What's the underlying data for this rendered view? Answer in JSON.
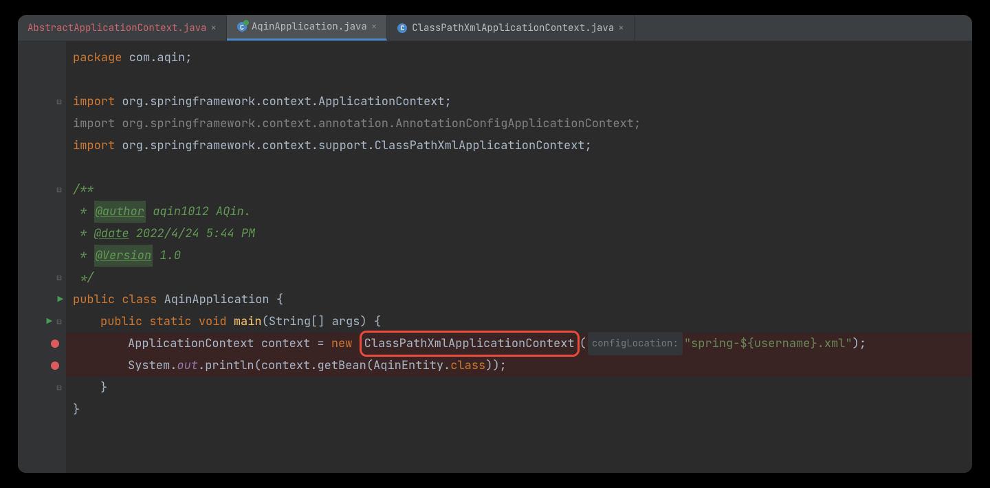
{
  "tabs": [
    {
      "label": "AbstractApplicationContext.java",
      "active": false,
      "error": true,
      "iconType": ""
    },
    {
      "label": "AqinApplication.java",
      "active": true,
      "error": false,
      "iconType": "c-active"
    },
    {
      "label": "ClassPathXmlApplicationContext.java",
      "active": false,
      "error": false,
      "iconType": "c"
    }
  ],
  "close_glyph": "×",
  "icon_c_letter": "C",
  "code": {
    "package_kw": "package ",
    "package_name": "com.aqin",
    "semicolon": ";",
    "import_kw": "import ",
    "import1": "org.springframework.context.ApplicationContext",
    "import2_full": "import org.springframework.context.annotation.AnnotationConfigApplicationContext;",
    "import3": "org.springframework.context.support.ClassPathXmlApplicationContext",
    "doc_open": "/**",
    "doc_star": " * ",
    "doc_author_tag": "@author",
    "doc_author_val": " aqin1012 AQin.",
    "doc_date_tag": "@date",
    "doc_date_val": " 2022/4/24 5:44 PM",
    "doc_version_tag": "@Version",
    "doc_version_val": " 1.0",
    "doc_close": " */",
    "public_kw": "public ",
    "class_kw": "class ",
    "class_name": "AqinApplication ",
    "brace_open": "{",
    "brace_close": "}",
    "static_kw": "static ",
    "void_kw": "void ",
    "main_name": "main",
    "main_args_open": "(",
    "string_type": "String",
    "brackets": "[] ",
    "args_name": "args",
    "main_args_close": ") ",
    "ctx_type": "ApplicationContext ",
    "ctx_var": "context ",
    "equals": "= ",
    "new_kw": "new ",
    "ctor_name": "ClassPathXmlApplicationContext",
    "paren_open": "(",
    "hint_config": "configLocation:",
    "config_str": "\"spring-${username}.xml\"",
    "paren_close_semi": ");",
    "system": "System.",
    "out": "out",
    "dot": ".",
    "println": "println",
    "ctx_var2": "context",
    "getBean": "getBean",
    "entity": "AqinEntity",
    "class_ref": "class",
    "close_inner": "))",
    "run_glyph": "▶"
  },
  "folds": {
    "minus_top": "⊟",
    "minus": "⊟",
    "end": "⊟"
  }
}
